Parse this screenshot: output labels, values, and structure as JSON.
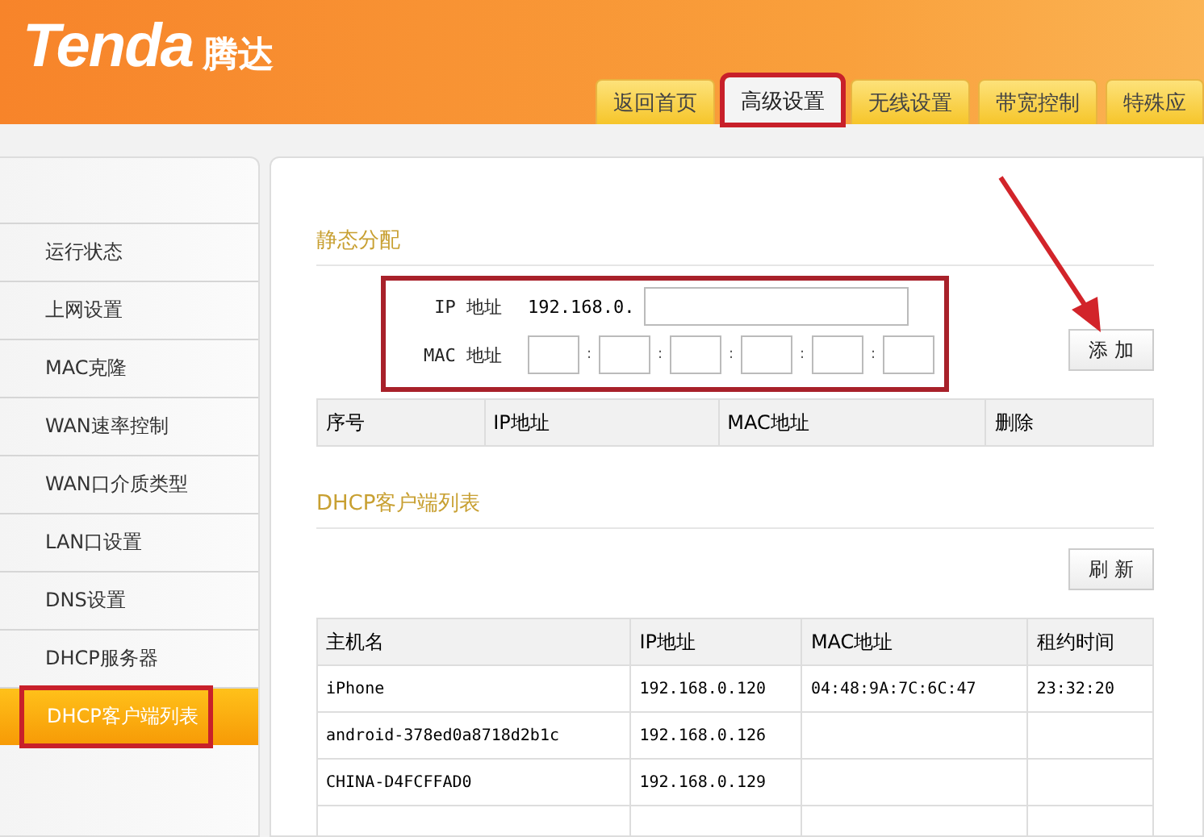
{
  "header": {
    "logo": "Tenda",
    "logo_cn": "腾达"
  },
  "tabs": [
    {
      "label": "返回首页",
      "selected": false,
      "highlighted": false
    },
    {
      "label": "高级设置",
      "selected": true,
      "highlighted": true
    },
    {
      "label": "无线设置",
      "selected": false,
      "highlighted": false
    },
    {
      "label": "带宽控制",
      "selected": false,
      "highlighted": false
    },
    {
      "label": "特殊应",
      "selected": false,
      "highlighted": false
    }
  ],
  "sidebar": {
    "items": [
      {
        "label": "运行状态",
        "selected": false,
        "highlighted": false
      },
      {
        "label": "上网设置",
        "selected": false,
        "highlighted": false
      },
      {
        "label": "MAC克隆",
        "selected": false,
        "highlighted": false
      },
      {
        "label": "WAN速率控制",
        "selected": false,
        "highlighted": false
      },
      {
        "label": "WAN口介质类型",
        "selected": false,
        "highlighted": false
      },
      {
        "label": "LAN口设置",
        "selected": false,
        "highlighted": false
      },
      {
        "label": "DNS设置",
        "selected": false,
        "highlighted": false
      },
      {
        "label": "DHCP服务器",
        "selected": false,
        "highlighted": false
      },
      {
        "label": "DHCP客户端列表",
        "selected": true,
        "highlighted": true
      }
    ]
  },
  "static_section": {
    "title": "静态分配",
    "highlighted": true,
    "ip_label": "IP 地址",
    "ip_prefix": "192.168.0.",
    "mac_label": "MAC 地址",
    "mac_separators": [
      ":",
      ":",
      ":",
      ":",
      ":"
    ],
    "add_button": "添 加",
    "table": {
      "columns": [
        "序号",
        "IP地址",
        "MAC地址",
        "删除"
      ]
    }
  },
  "client_section": {
    "title": "DHCP客户端列表",
    "refresh_button": "刷 新",
    "table": {
      "columns": [
        "主机名",
        "IP地址",
        "MAC地址",
        "租约时间"
      ],
      "rows": [
        [
          "iPhone",
          "192.168.0.120",
          "04:48:9A:7C:6C:47",
          "23:32:20"
        ],
        [
          "android-378ed0a8718d2b1c",
          "192.168.0.126"
        ],
        [
          "CHINA-D4FCFFAD0",
          "192.168.0.129"
        ],
        []
      ]
    }
  }
}
